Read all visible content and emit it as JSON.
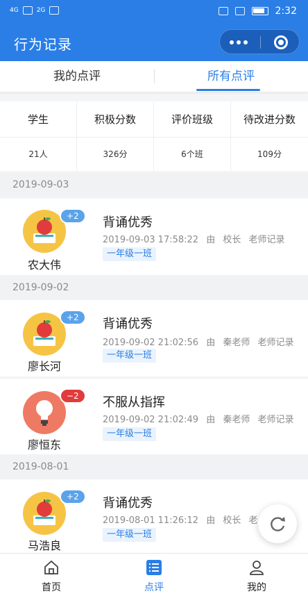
{
  "status_bar": {
    "network_1": "4G",
    "network_2": "2G",
    "time": "2:32"
  },
  "header": {
    "title": "行为记录",
    "more_icon": "more-dots-icon",
    "close_icon": "target-icon"
  },
  "tabs": [
    {
      "label": "我的点评",
      "active": false
    },
    {
      "label": "所有点评",
      "active": true
    }
  ],
  "stats": {
    "headers": [
      "学生",
      "积极分数",
      "评价班级",
      "待改进分数"
    ],
    "values": [
      "21人",
      "326分",
      "6个班",
      "109分"
    ]
  },
  "dates": [
    "2019-09-03",
    "2019-09-02",
    "2019-08-01"
  ],
  "records": [
    {
      "name": "农大伟",
      "badge": "+2",
      "title": "背诵优秀",
      "datetime": "2019-09-03 17:58:22",
      "by": "由",
      "recorder": "校长",
      "role": "老师记录",
      "class": "一年级一班",
      "icon": "apple-book-icon"
    },
    {
      "name": "廖长河",
      "badge": "+2",
      "title": "背诵优秀",
      "datetime": "2019-09-02 21:02:56",
      "by": "由",
      "recorder": "秦老师",
      "role": "老师记录",
      "class": "一年级一班",
      "icon": "apple-book-icon"
    },
    {
      "name": "廖恒东",
      "badge": "−2",
      "title": "不服从指挥",
      "datetime": "2019-09-02 21:02:49",
      "by": "由",
      "recorder": "秦老师",
      "role": "老师记录",
      "class": "一年级一班",
      "icon": "lightbulb-icon"
    },
    {
      "name": "马浩良",
      "badge": "+2",
      "title": "背诵优秀",
      "datetime": "2019-08-01 11:26:12",
      "by": "由",
      "recorder": "校长",
      "role": "老",
      "class": "一年级一班",
      "icon": "apple-book-icon"
    }
  ],
  "bottom_nav": [
    {
      "label": "首页",
      "icon": "home-icon",
      "active": false
    },
    {
      "label": "点评",
      "icon": "list-icon",
      "active": true
    },
    {
      "label": "我的",
      "icon": "user-icon",
      "active": false
    }
  ],
  "colors": {
    "primary": "#2a7ee6",
    "positive_badge": "#5aa3ea",
    "negative_badge": "#e23b3b"
  }
}
